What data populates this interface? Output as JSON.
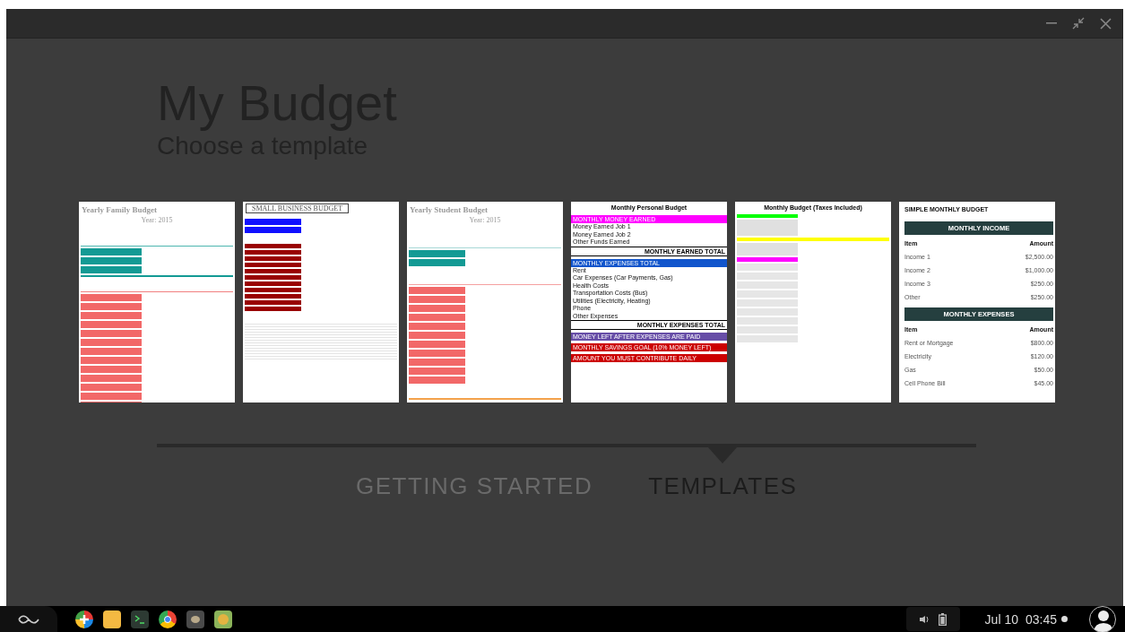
{
  "app": {
    "title": "My Budget",
    "subtitle": "Choose a template"
  },
  "templates": [
    {
      "kind": "family",
      "title": "Yearly Family Budget",
      "subtitle": "Year: 2015"
    },
    {
      "kind": "business",
      "title": "SMALL BUSINESS BUDGET"
    },
    {
      "kind": "student",
      "title": "Yearly Student Budget",
      "subtitle": "Year: 2015"
    },
    {
      "kind": "personal",
      "title": "Monthly Personal Budget",
      "sections": [
        {
          "header": "MONTHLY MONEY EARNED",
          "color": "#ff00ff",
          "items": [
            "Money Earned Job 1",
            "Money Earned Job 2",
            "Other Funds Earned"
          ],
          "total": "MONTHLY EARNED TOTAL"
        },
        {
          "header": "MONTHLY EXPENSES TOTAL",
          "color": "#1155cc",
          "items": [
            "Rent",
            "Car Expenses (Car Payments, Gas)",
            "Health Costs",
            "Transportation Costs (Bus)",
            "Utilities (Electricity, Heating)",
            "Phone",
            "Other Expenses"
          ],
          "total": "MONTHLY EXPENSES TOTAL"
        },
        {
          "header": "MONEY LEFT AFTER EXPENSES ARE PAID",
          "color": "#674ea7"
        },
        {
          "header": "MONTHLY SAVINGS GOAL (10% MONEY LEFT)",
          "color": "#cc0000"
        },
        {
          "header": "AMOUNT YOU MUST CONTRIBUTE DAILY",
          "color": "#cc0000"
        }
      ]
    },
    {
      "kind": "taxes",
      "title": "Monthly Budget (Taxes Included)"
    },
    {
      "kind": "simple",
      "title": "SIMPLE MONTHLY BUDGET",
      "sections": [
        {
          "header": "MONTHLY INCOME",
          "columns": [
            "Item",
            "Amount"
          ],
          "rows": [
            [
              "Income 1",
              "$2,500.00"
            ],
            [
              "Income 2",
              "$1,000.00"
            ],
            [
              "Income 3",
              "$250.00"
            ],
            [
              "Other",
              "$250.00"
            ]
          ]
        },
        {
          "header": "MONTHLY EXPENSES",
          "columns": [
            "Item",
            "Amount"
          ],
          "rows": [
            [
              "Rent or Mortgage",
              "$800.00"
            ],
            [
              "Electricity",
              "$120.00"
            ],
            [
              "Gas",
              "$50.00"
            ],
            [
              "Cell Phone Bill",
              "$45.00"
            ]
          ]
        }
      ]
    }
  ],
  "tabs": [
    {
      "label": "GETTING STARTED",
      "selected": false
    },
    {
      "label": "TEMPLATES",
      "selected": true
    }
  ],
  "taskbar": {
    "date": "Jul 10",
    "time": "03:45"
  }
}
